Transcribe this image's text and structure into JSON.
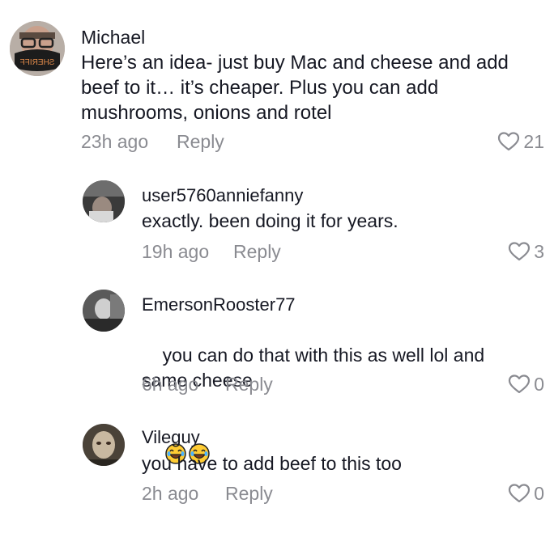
{
  "comments": [
    {
      "username": "Michael",
      "text": "Here’s an idea- just buy Mac and cheese and add beef to it… it’s cheaper. Plus you can add mushrooms, onions and rotel",
      "time": "23h ago",
      "reply_label": "Reply",
      "likes": "21",
      "avatar_text": "SHERIFF"
    },
    {
      "username": "user5760anniefanny",
      "text": "exactly. been doing it for years.",
      "time": "19h ago",
      "reply_label": "Reply",
      "likes": "3"
    },
    {
      "username": "EmersonRooster77",
      "text": "you can do that with this as well lol and same cheese",
      "emojis": [
        "😂",
        "😂"
      ],
      "time": "6h ago",
      "reply_label": "Reply",
      "likes": "0"
    },
    {
      "username": "Vileguy",
      "text": "you have to add beef to this too",
      "time": "2h ago",
      "reply_label": "Reply",
      "likes": "0"
    }
  ],
  "colors": {
    "text": "#161823",
    "muted": "#8a8b91",
    "background": "#ffffff"
  }
}
